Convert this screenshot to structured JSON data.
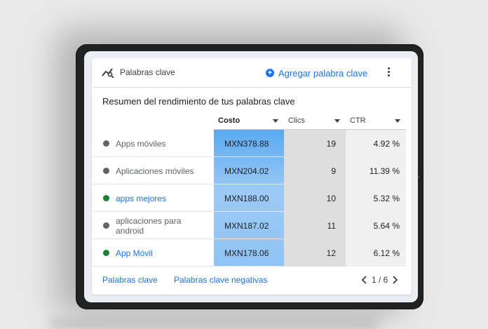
{
  "card": {
    "title": "Palabras clave",
    "add_button_label": "Agregar palabra clave",
    "add_icon_glyph": "+",
    "summary": "Resumen del rendimiento de tus palabras clave"
  },
  "table": {
    "columns": [
      "Costo",
      "Clics",
      "CTR"
    ],
    "rows": [
      {
        "keyword": "Apps móviles",
        "status": "gray",
        "costo": "MXN378.88",
        "clics": "19",
        "ctr": "4.92 %"
      },
      {
        "keyword": "Aplicaciones móviles",
        "status": "gray",
        "costo": "MXN204.02",
        "clics": "9",
        "ctr": "11.39 %"
      },
      {
        "keyword": "apps mejores",
        "status": "green",
        "costo": "MXN188.00",
        "clics": "10",
        "ctr": "5.32 %"
      },
      {
        "keyword": "aplicaciones para android",
        "status": "gray",
        "costo": "MXN187.02",
        "clics": "11",
        "ctr": "5.64 %"
      },
      {
        "keyword": "App Móvil",
        "status": "green",
        "costo": "MXN178.06",
        "clics": "12",
        "ctr": "6.12 %"
      }
    ],
    "costo_bar_fraction": [
      1.0,
      0.54,
      0.5,
      0.49,
      0.47
    ]
  },
  "footer": {
    "link_keywords": "Palabras clave",
    "link_negative": "Palabras clave negativas",
    "pagination": "1 / 6"
  },
  "colors": {
    "accent": "#1a73e8",
    "status_gray": "#5f6368",
    "status_green": "#188038",
    "costo_bar_top": "#5aa9f0",
    "costo_bar_bottom": "#8fc3f4",
    "costo_col_bg": "#9ccaf6"
  },
  "icons": {
    "card_icon": "trend-search-icon",
    "add_icon": "plus-circle-icon",
    "more_icon": "more-vert-icon",
    "prev_icon": "chevron-left-icon",
    "next_icon": "chevron-right-icon",
    "sort_icon": "caret-down-icon"
  }
}
